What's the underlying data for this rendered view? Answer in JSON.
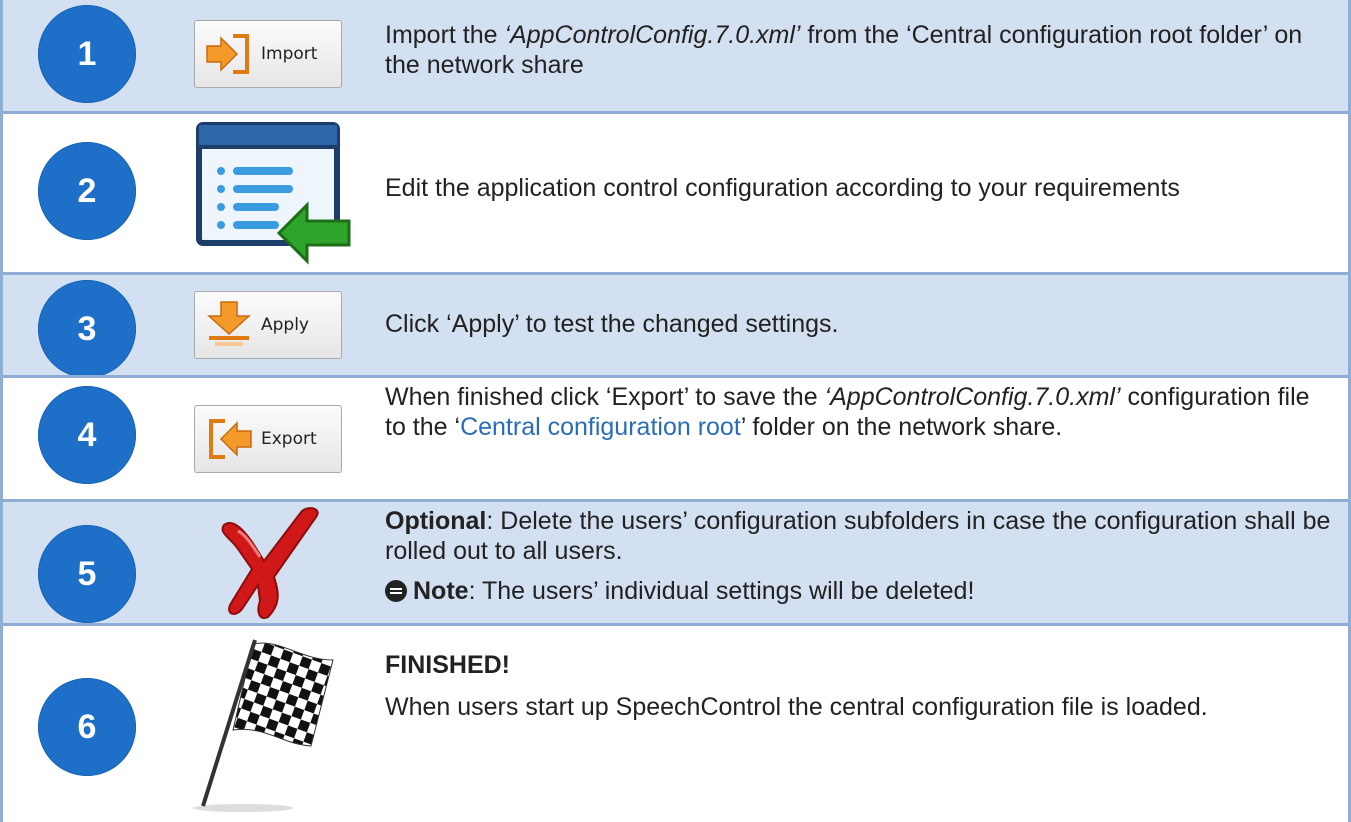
{
  "steps": [
    {
      "number": "1",
      "icon": "import-button-icon",
      "icon_label": "Import",
      "text_parts": [
        "Import the ",
        "‘AppControlConfig.7.0.xml’",
        " from the ‘Central configuration root folder’ on the network share"
      ]
    },
    {
      "number": "2",
      "icon": "edit-list-icon",
      "text": "Edit the application control configuration according to your requirements"
    },
    {
      "number": "3",
      "icon": "apply-button-icon",
      "icon_label": "Apply",
      "text": "Click ‘Apply’ to test the changed settings."
    },
    {
      "number": "4",
      "icon": "export-button-icon",
      "icon_label": "Export",
      "text_parts": [
        "When finished click ‘Export’ to save the ",
        "‘AppControlConfig.7.0.xml’",
        " configuration file to the ‘",
        "Central configuration root",
        "’ folder on the network share."
      ]
    },
    {
      "number": "5",
      "icon": "red-x-icon",
      "optional_label": "Optional",
      "optional_text": ": Delete the users’ configuration subfolders in case the configuration shall be rolled out to all users.",
      "note_label": "Note",
      "note_text": ": The users’ individual settings will be deleted!"
    },
    {
      "number": "6",
      "icon": "checkered-flag-icon",
      "heading": "FINISHED!",
      "text": "When users start up SpeechControl the central configuration file is loaded."
    }
  ],
  "colors": {
    "row_shade": "#d3e0f1",
    "border": "#8eaed6",
    "badge": "#1e6fc8",
    "link": "#2a6db7"
  }
}
